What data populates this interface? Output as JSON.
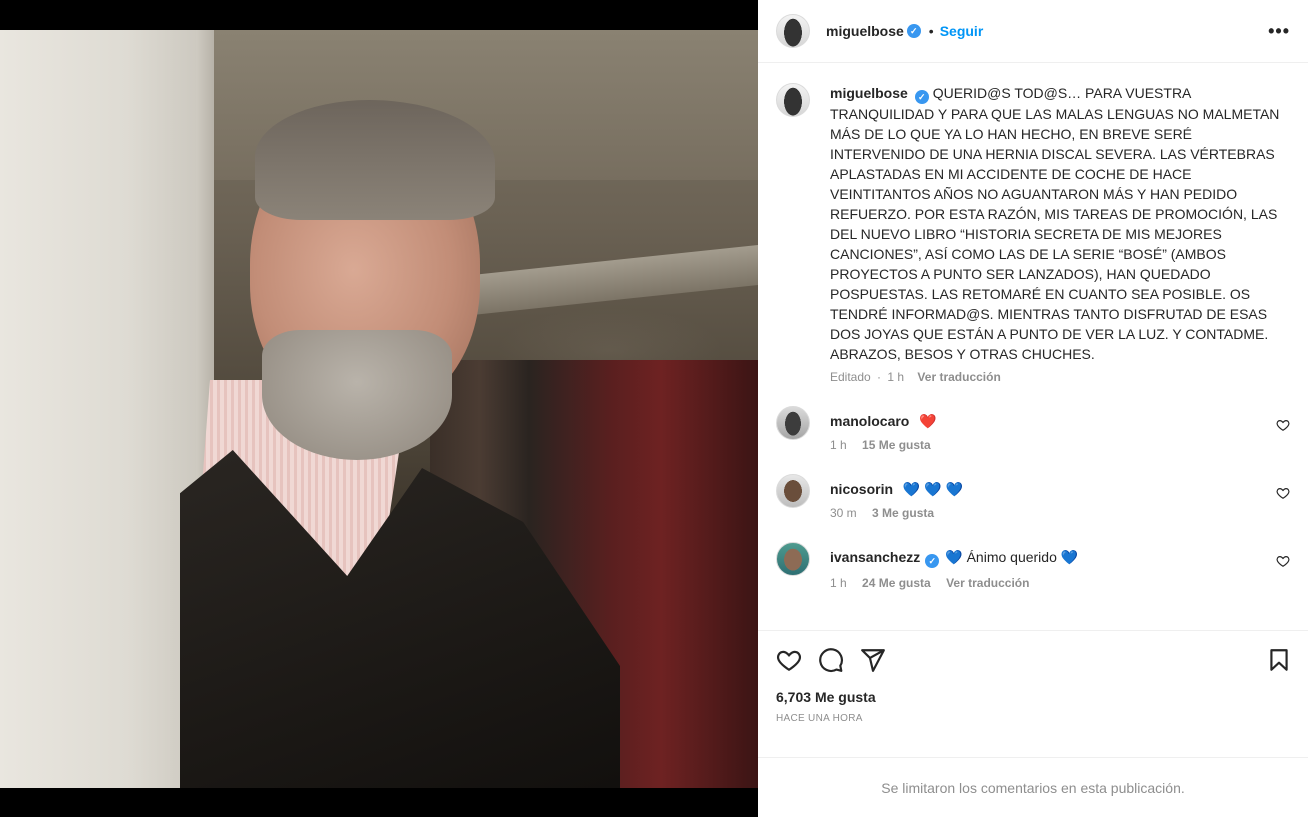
{
  "post": {
    "author": "miguelbose",
    "follow_label": "Seguir",
    "dot": "•",
    "more_label": "•••",
    "verified_mark": "✓"
  },
  "caption": {
    "username": "miguelbose",
    "text": "QUERID@S TOD@S… PARA VUESTRA TRANQUILIDAD Y PARA QUE LAS MALAS LENGUAS NO MALMETAN MÁS DE LO QUE YA LO HAN HECHO, EN BREVE SERÉ INTERVENIDO DE UNA HERNIA DISCAL SEVERA. LAS VÉRTEBRAS APLASTADAS EN MI ACCIDENTE DE COCHE DE HACE VEINTITANTOS AÑOS NO AGUANTARON MÁS Y HAN PEDIDO REFUERZO. POR ESTA RAZÓN, MIS TAREAS DE PROMOCIÓN, LAS DEL NUEVO LIBRO “HISTORIA SECRETA DE MIS MEJORES CANCIONES”, ASÍ COMO LAS DE LA SERIE “BOSÉ” (AMBOS PROYECTOS A PUNTO SER LANZADOS), HAN QUEDADO POSPUESTAS. LAS RETOMARÉ EN CUANTO SEA POSIBLE. OS TENDRÉ INFORMAD@S. MIENTRAS TANTO DISFRUTAD DE ESAS DOS JOYAS QUE ESTÁN A PUNTO DE VER LA LUZ. Y CONTADME. ABRAZOS, BESOS Y OTRAS CHUCHES.",
    "edited": "Editado",
    "sep": "·",
    "time": "1 h",
    "translate": "Ver traducción"
  },
  "comments": [
    {
      "username": "manolocaro",
      "text": "❤️",
      "time": "1 h",
      "likes": "15 Me gusta",
      "verified": false,
      "translate": ""
    },
    {
      "username": "nicosorin",
      "text": "💙 💙 💙",
      "time": "30 m",
      "likes": "3 Me gusta",
      "verified": false,
      "translate": ""
    },
    {
      "username": "ivansanchezz",
      "text_pre": "💙",
      "text": " Ánimo querido ",
      "text_post": "💙",
      "time": "1 h",
      "likes": "24 Me gusta",
      "verified": true,
      "translate": "Ver traducción"
    }
  ],
  "likes": {
    "count": "6,703",
    "label": "Me gusta"
  },
  "timeago": "HACE UNA HORA",
  "limited_comments": "Se limitaron los comentarios en esta publicación.",
  "colors": {
    "accent": "#0095f6",
    "verified": "#3897f0",
    "secondary_text": "#8e8e8e",
    "red_heart": "#ed4956",
    "blue_heart": "#1877c9"
  },
  "icons": {
    "like": "heart-outline-icon",
    "comment": "speech-bubble-icon",
    "share": "paper-plane-icon",
    "save": "bookmark-icon",
    "more": "more-dots-icon",
    "verified": "verified-badge-icon"
  }
}
